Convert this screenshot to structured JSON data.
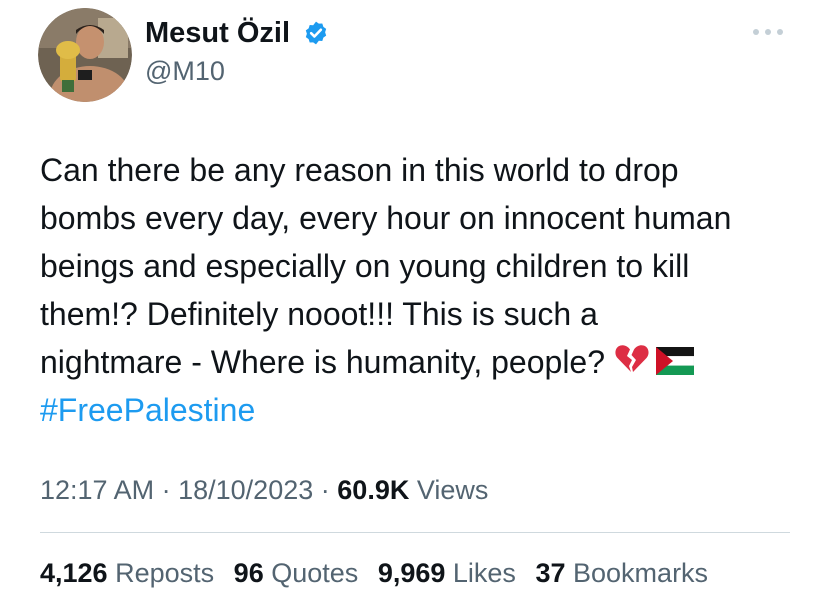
{
  "author": {
    "display_name": "Mesut Özil",
    "handle": "@M10",
    "verified": true
  },
  "tweet": {
    "lines": [
      "Can there be any reason in this world to drop",
      "bombs every day, every hour on innocent human",
      "beings and especially on young children to kill",
      "them!? Definitely nooot!!! This is such a",
      "nightmare - Where is humanity, people?"
    ],
    "emojis": [
      "broken-heart-emoji",
      "palestine-flag-emoji"
    ],
    "hashtag": "#FreePalestine"
  },
  "meta": {
    "time": "12:17 AM",
    "separator": "·",
    "date": "18/10/2023",
    "views_count": "60.9K",
    "views_label": "Views"
  },
  "stats": {
    "reposts_count": "4,126",
    "reposts_label": "Reposts",
    "quotes_count": "96",
    "quotes_label": "Quotes",
    "likes_count": "9,969",
    "likes_label": "Likes",
    "bookmarks_count": "37",
    "bookmarks_label": "Bookmarks"
  },
  "colors": {
    "text": "#0f1419",
    "secondary": "#536471",
    "accent": "#1d9bf0",
    "divider": "#cfd9de"
  },
  "icons": [
    "verified-badge-icon",
    "more-options-icon"
  ]
}
